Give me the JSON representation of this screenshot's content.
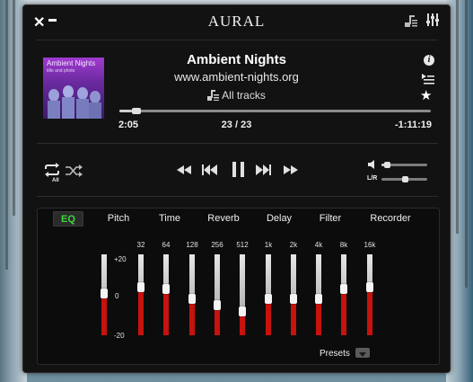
{
  "window": {
    "title": "AURAL"
  },
  "now_playing": {
    "album_art": {
      "title": "Ambient Nights",
      "subtitle": "title and photo"
    },
    "title": "Ambient Nights",
    "url": "www.ambient-nights.org",
    "filter_label": "All tracks",
    "position": {
      "elapsed": "2:05",
      "counter": "23 / 23",
      "remaining": "-1:11:19",
      "progress_fraction": 0.04
    }
  },
  "transport": {
    "repeat_label": "All",
    "volume_fraction": 0.1,
    "balance_label": "L/R",
    "balance_fraction": 0.5
  },
  "tabs": [
    {
      "label": "EQ",
      "active": true
    },
    {
      "label": "Pitch",
      "active": false
    },
    {
      "label": "Time",
      "active": false
    },
    {
      "label": "Reverb",
      "active": false
    },
    {
      "label": "Delay",
      "active": false
    },
    {
      "label": "Filter",
      "active": false
    },
    {
      "label": "Recorder",
      "active": false
    }
  ],
  "eq": {
    "scale_max": "+20",
    "scale_mid": "0",
    "scale_min": "-20",
    "preamp_level": 0.52,
    "bands": [
      {
        "freq": "32",
        "level": 0.6
      },
      {
        "freq": "64",
        "level": 0.58
      },
      {
        "freq": "128",
        "level": 0.45
      },
      {
        "freq": "256",
        "level": 0.38
      },
      {
        "freq": "512",
        "level": 0.3
      },
      {
        "freq": "1k",
        "level": 0.45
      },
      {
        "freq": "2k",
        "level": 0.45
      },
      {
        "freq": "4k",
        "level": 0.45
      },
      {
        "freq": "8k",
        "level": 0.58
      },
      {
        "freq": "16k",
        "level": 0.6
      }
    ],
    "presets_label": "Presets"
  },
  "colors": {
    "accent": "#3fd63f",
    "eq_fill": "#c8120d",
    "window_bg": "#121212"
  }
}
